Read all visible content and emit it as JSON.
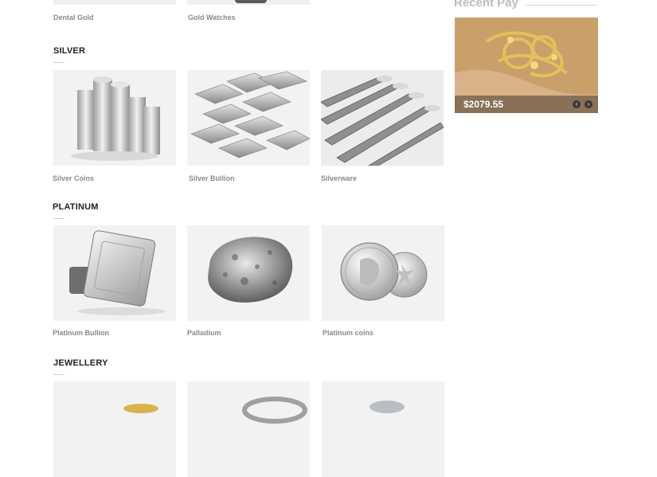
{
  "top_row": {
    "captions": [
      "Dental Gold",
      "Gold Watches"
    ]
  },
  "sections": {
    "silver": {
      "title": "SILVER",
      "items": [
        "Silver Coins",
        "Silver Bullion",
        "Silverware"
      ]
    },
    "platinum": {
      "title": "PLATINUM",
      "items": [
        "Platinum Bullion",
        "Palladium",
        "Platinum coins"
      ]
    },
    "jewellery": {
      "title": "JEWELLERY"
    }
  },
  "recent_pay": {
    "title": "Recent Pay",
    "amount": "$2079.55",
    "prev_label": "‹",
    "next_label": "›"
  },
  "colors": {
    "tile_bg": "#f2f2f2",
    "caption": "#8a8a8a",
    "heading": "#222222"
  }
}
